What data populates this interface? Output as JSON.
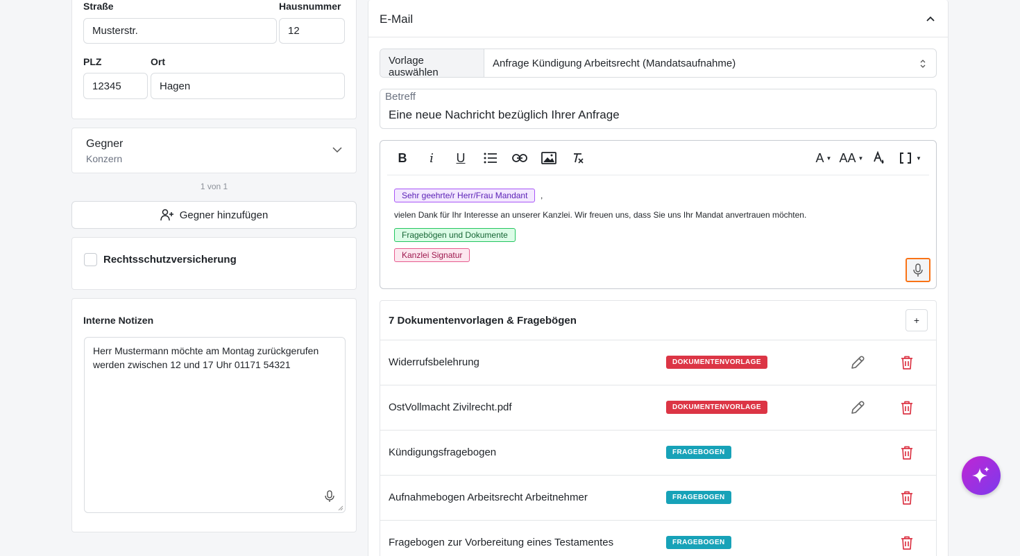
{
  "address": {
    "street_label": "Straße",
    "street_value": "Musterstr.",
    "house_label": "Hausnummer",
    "house_value": "12",
    "zip_label": "PLZ",
    "zip_value": "12345",
    "city_label": "Ort",
    "city_value": "Hagen"
  },
  "opponent": {
    "title": "Gegner",
    "subtitle": "Konzern",
    "pager": "1 von 1",
    "add_label": "Gegner hinzufügen"
  },
  "insurance": {
    "label": "Rechtsschutzversicherung",
    "checked": false
  },
  "notes": {
    "label": "Interne Notizen",
    "value": "Herr Mustermann möchte am Montag zurückgerufen werden zwischen 12 und 17 Uhr 01171 54321"
  },
  "email": {
    "title": "E-Mail",
    "template_label": "Vorlage auswählen",
    "template_value": "Anfrage Kündigung Arbeitsrecht (Mandatsaufnahme)",
    "subject_label": "Betreff",
    "subject_value": "Eine neue Nachricht bezüglich Ihrer Anfrage",
    "toolbar": {
      "bold": "B",
      "italic": "i",
      "underline": "U",
      "font_color": "A",
      "font_size": "AA"
    },
    "body": {
      "chip_salutation": "Sehr geehrte/r Herr/Frau Mandant",
      "comma": ",",
      "line": "vielen Dank für Ihr Interesse an unserer Kanzlei. Wir freuen uns, dass Sie uns Ihr Mandat anvertrauen möchten.",
      "chip_docs": "Fragebögen und Dokumente",
      "chip_signature": "Kanzlei Signatur"
    }
  },
  "documents": {
    "title": "7 Dokumentenvorlagen & Fragebögen",
    "add_label": "+",
    "rows": [
      {
        "name": "Widerrufsbelehrung",
        "badge": "DOKUMENTENVORLAGE",
        "editable": true
      },
      {
        "name": "OstVollmacht Zivilrecht.pdf",
        "badge": "DOKUMENTENVORLAGE",
        "editable": true
      },
      {
        "name": "Kündigungsfragebogen",
        "badge": "FRAGEBOGEN",
        "editable": false
      },
      {
        "name": "Aufnahmebogen Arbeitsrecht Arbeitnehmer",
        "badge": "FRAGEBOGEN",
        "editable": false
      },
      {
        "name": "Fragebogen zur Vorbereitung eines Testamentes",
        "badge": "FRAGEBOGEN",
        "editable": false
      }
    ]
  },
  "colors": {
    "badge_document": "#dc3545",
    "badge_questionnaire": "#17a2b8",
    "delete": "#dc3545",
    "mic_highlight": "#f97316",
    "ai_gradient_start": "#c026d3",
    "ai_gradient_end": "#7c3aed"
  }
}
